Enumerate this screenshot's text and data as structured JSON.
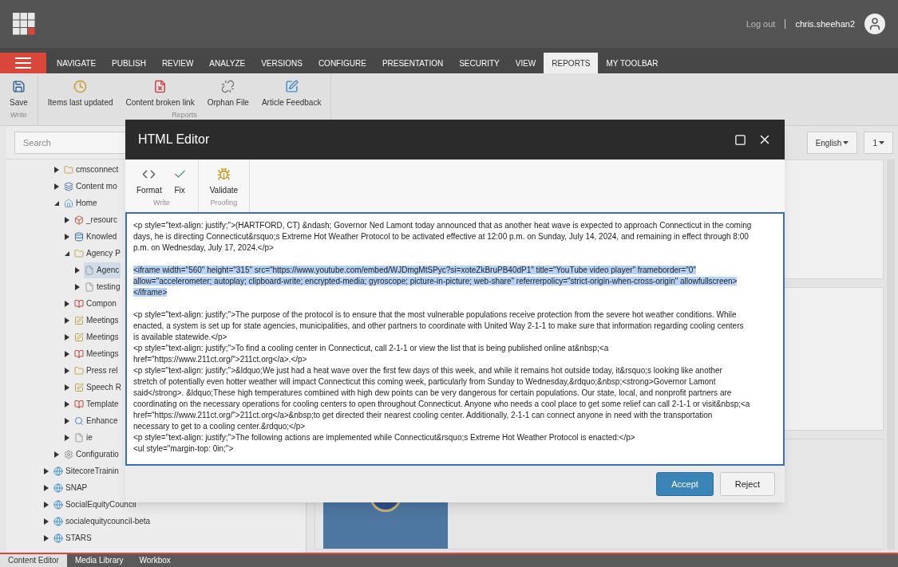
{
  "top_bar": {
    "logout": "Log out",
    "user": "chris.sheehan2"
  },
  "ribbon_tabs": [
    {
      "label": "NAVIGATE",
      "selected": false
    },
    {
      "label": "PUBLISH",
      "selected": false
    },
    {
      "label": "REVIEW",
      "selected": false
    },
    {
      "label": "ANALYZE",
      "selected": false
    },
    {
      "label": "VERSIONS",
      "selected": false
    },
    {
      "label": "CONFIGURE",
      "selected": false
    },
    {
      "label": "PRESENTATION",
      "selected": false
    },
    {
      "label": "SECURITY",
      "selected": false
    },
    {
      "label": "VIEW",
      "selected": false
    },
    {
      "label": "REPORTS",
      "selected": true
    },
    {
      "label": "MY TOOLBAR",
      "selected": false
    }
  ],
  "ribbon_groups": [
    {
      "label": "Write",
      "commands": [
        {
          "kind": "save",
          "label": "Save"
        }
      ]
    },
    {
      "label": "Reports",
      "commands": [
        {
          "kind": "clock",
          "label": "Items last updated"
        },
        {
          "kind": "broken",
          "label": "Content broken link"
        },
        {
          "kind": "orphan",
          "label": "Orphan File"
        },
        {
          "kind": "feedback",
          "label": "Article Feedback"
        }
      ]
    }
  ],
  "search": {
    "placeholder": "Search"
  },
  "language_dropdowns": [
    {
      "label": "English"
    },
    {
      "label": "1"
    }
  ],
  "tree": {
    "nested_items": [
      {
        "kind": "folder",
        "label": "cmsconnect",
        "expanded": false,
        "selected": false
      },
      {
        "kind": "module",
        "label": "Content mo",
        "expanded": false,
        "selected": false
      },
      {
        "kind": "home",
        "label": "Home",
        "expanded": true,
        "selected": false,
        "children": [
          {
            "kind": "repository",
            "label": "_resourc",
            "expanded": false,
            "selected": false
          },
          {
            "kind": "data",
            "label": "Knowled",
            "expanded": false,
            "selected": false
          },
          {
            "kind": "folder",
            "label": "Agency P",
            "expanded": true,
            "selected": false,
            "children": [
              {
                "kind": "page",
                "label": "Agenc",
                "expanded": false,
                "selected": true
              },
              {
                "kind": "page",
                "label": "testing",
                "expanded": false,
                "selected": false
              }
            ]
          },
          {
            "kind": "component",
            "label": "Compon",
            "expanded": false,
            "selected": false
          },
          {
            "kind": "template",
            "label": "Meetings",
            "expanded": false,
            "selected": false
          },
          {
            "kind": "template",
            "label": "Meetings",
            "expanded": false,
            "selected": false
          },
          {
            "kind": "component",
            "label": "Meetings",
            "expanded": false,
            "selected": false
          },
          {
            "kind": "folder",
            "label": "Press rel",
            "expanded": false,
            "selected": false
          },
          {
            "kind": "template",
            "label": "Speech R",
            "expanded": false,
            "selected": false
          },
          {
            "kind": "component",
            "label": "Template",
            "expanded": false,
            "selected": false
          },
          {
            "kind": "search",
            "label": "Enhance",
            "expanded": false,
            "selected": false
          },
          {
            "kind": "page",
            "label": "ie",
            "expanded": false,
            "selected": false
          }
        ]
      },
      {
        "kind": "settings",
        "label": "Configuratio",
        "expanded": false,
        "selected": false
      }
    ],
    "items": [
      {
        "kind": "site",
        "label": "SitecoreTrainin",
        "expanded": false,
        "selected": false
      },
      {
        "kind": "site",
        "label": "SNAP",
        "expanded": false,
        "selected": false
      },
      {
        "kind": "site",
        "label": "SocialEquityCouncil",
        "expanded": false,
        "selected": false
      },
      {
        "kind": "site",
        "label": "socialequitycouncil-beta",
        "expanded": false,
        "selected": false
      },
      {
        "kind": "site",
        "label": "STARS",
        "expanded": false,
        "selected": false
      }
    ]
  },
  "bottom_tabs": [
    {
      "label": "Content Editor",
      "selected": true
    },
    {
      "label": "Media Library",
      "selected": false
    },
    {
      "label": "Workbox",
      "selected": false
    }
  ],
  "dialog": {
    "title": "HTML Editor",
    "toolbar_groups": [
      {
        "label": "Write",
        "commands": [
          {
            "kind": "format",
            "label": "Format"
          },
          {
            "kind": "fix",
            "label": "Fix"
          }
        ]
      },
      {
        "label": "Proofing",
        "commands": [
          {
            "kind": "validate",
            "label": "Validate"
          }
        ]
      }
    ],
    "editor_blocks": [
      {
        "selected": false,
        "lines": [
          "<p style=\"text-align: justify;\">(HARTFORD, CT) &ndash; Governor Ned Lamont today announced that as another heat wave is expected to approach Connecticut in the coming",
          "days, he is directing Connecticut&rsquo;s Extreme Hot Weather Protocol to be activated effective at 12:00 p.m. on Sunday, July 14, 2024, and remaining in effect through 8:00",
          "p.m. on Wednesday, July 17, 2024.</p>"
        ]
      },
      {
        "selected": true,
        "lines": [
          "<iframe width=\"560\" height=\"315\" src=\"https://www.youtube.com/embed/WJDmgMtSPyc?si=xoteZkBruPB40dP1\" title=\"YouTube video player\" frameborder=\"0\"",
          "allow=\"accelerometer; autoplay; clipboard-write; encrypted-media; gyroscope; picture-in-picture; web-share\" referrerpolicy=\"strict-origin-when-cross-origin\" allowfullscreen>",
          "</iframe>"
        ]
      },
      {
        "selected": false,
        "lines": [
          "<p style=\"text-align: justify;\">The purpose of the protocol is to ensure that the most vulnerable populations receive protection from the severe hot weather conditions. While",
          "enacted, a system is set up for state agencies, municipalities, and other partners to coordinate with United Way 2-1-1 to make sure that information regarding cooling centers",
          "is available statewide.</p>",
          "<p style=\"text-align: justify;\">To find a cooling center in Connecticut, call 2-1-1 or view the list that is being published online at&nbsp;<a",
          "href=\"https://www.211ct.org/\">211ct.org</a>.</p>",
          "<p style=\"text-align: justify;\">&ldquo;We just had a heat wave over the first few days of this week, and while it remains hot outside today, it&rsquo;s looking like another",
          "stretch of potentially even hotter weather will impact Connecticut this coming week, particularly from Sunday to Wednesday,&rdquo;&nbsp;<strong>Governor Lamont",
          "said</strong>. &ldquo;These high temperatures combined with high dew points can be very dangerous for certain populations. Our state, local, and nonprofit partners are",
          "coordinating on the necessary operations for cooling centers to open throughout Connecticut. Anyone who needs a cool place to get some relief can call 2-1-1 or visit&nbsp;<a",
          "href=\"https://www.211ct.org/\">211ct.org</a>&nbsp;to get directed their nearest cooling center. Additionally, 2-1-1 can connect anyone in need with the transportation",
          "necessary to get to a cooling center.&rdquo;</p>",
          "<p style=\"text-align: justify;\">The following actions are implemented while Connecticut&rsquo;s Extreme Hot Weather Protocol is enacted:</p>",
          "<ul style=\"margin-top: 0in;\">"
        ]
      }
    ],
    "buttons": [
      {
        "kind": "primary",
        "label": "Accept"
      },
      {
        "kind": "secondary",
        "label": "Reject"
      }
    ]
  }
}
